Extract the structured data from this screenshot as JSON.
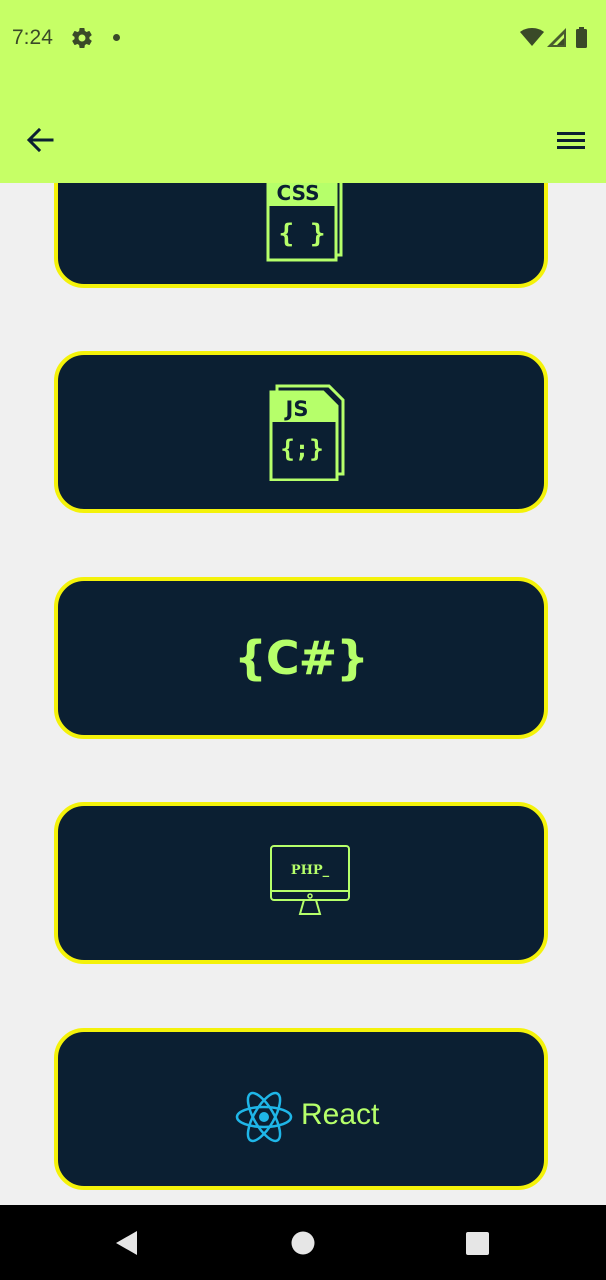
{
  "status_bar": {
    "time": "7:24",
    "icons": [
      "gear-icon",
      "notification-dot-icon",
      "wifi-icon",
      "signal-icon",
      "battery-icon"
    ]
  },
  "app_bar": {
    "color": "#c6ff66",
    "back_icon": "arrow-left-icon",
    "menu_icon": "hamburger-menu-icon"
  },
  "cards": [
    {
      "name": "css",
      "icon_text": "CSS",
      "icon_body": "{ }"
    },
    {
      "name": "javascript",
      "icon_text": "JS",
      "icon_body": "{;}"
    },
    {
      "name": "csharp",
      "label": "{C#}"
    },
    {
      "name": "php",
      "icon_text": "PHP_"
    },
    {
      "name": "react",
      "label": "React"
    }
  ],
  "colors": {
    "card_bg": "#0b1f32",
    "card_border": "#f4f20a",
    "accent": "#b6ff6a",
    "react_blue": "#1fb6e8",
    "page_bg": "#f0f0f0"
  },
  "nav_bar": {
    "buttons": [
      "back-triangle-icon",
      "home-circle-icon",
      "recents-square-icon"
    ]
  }
}
